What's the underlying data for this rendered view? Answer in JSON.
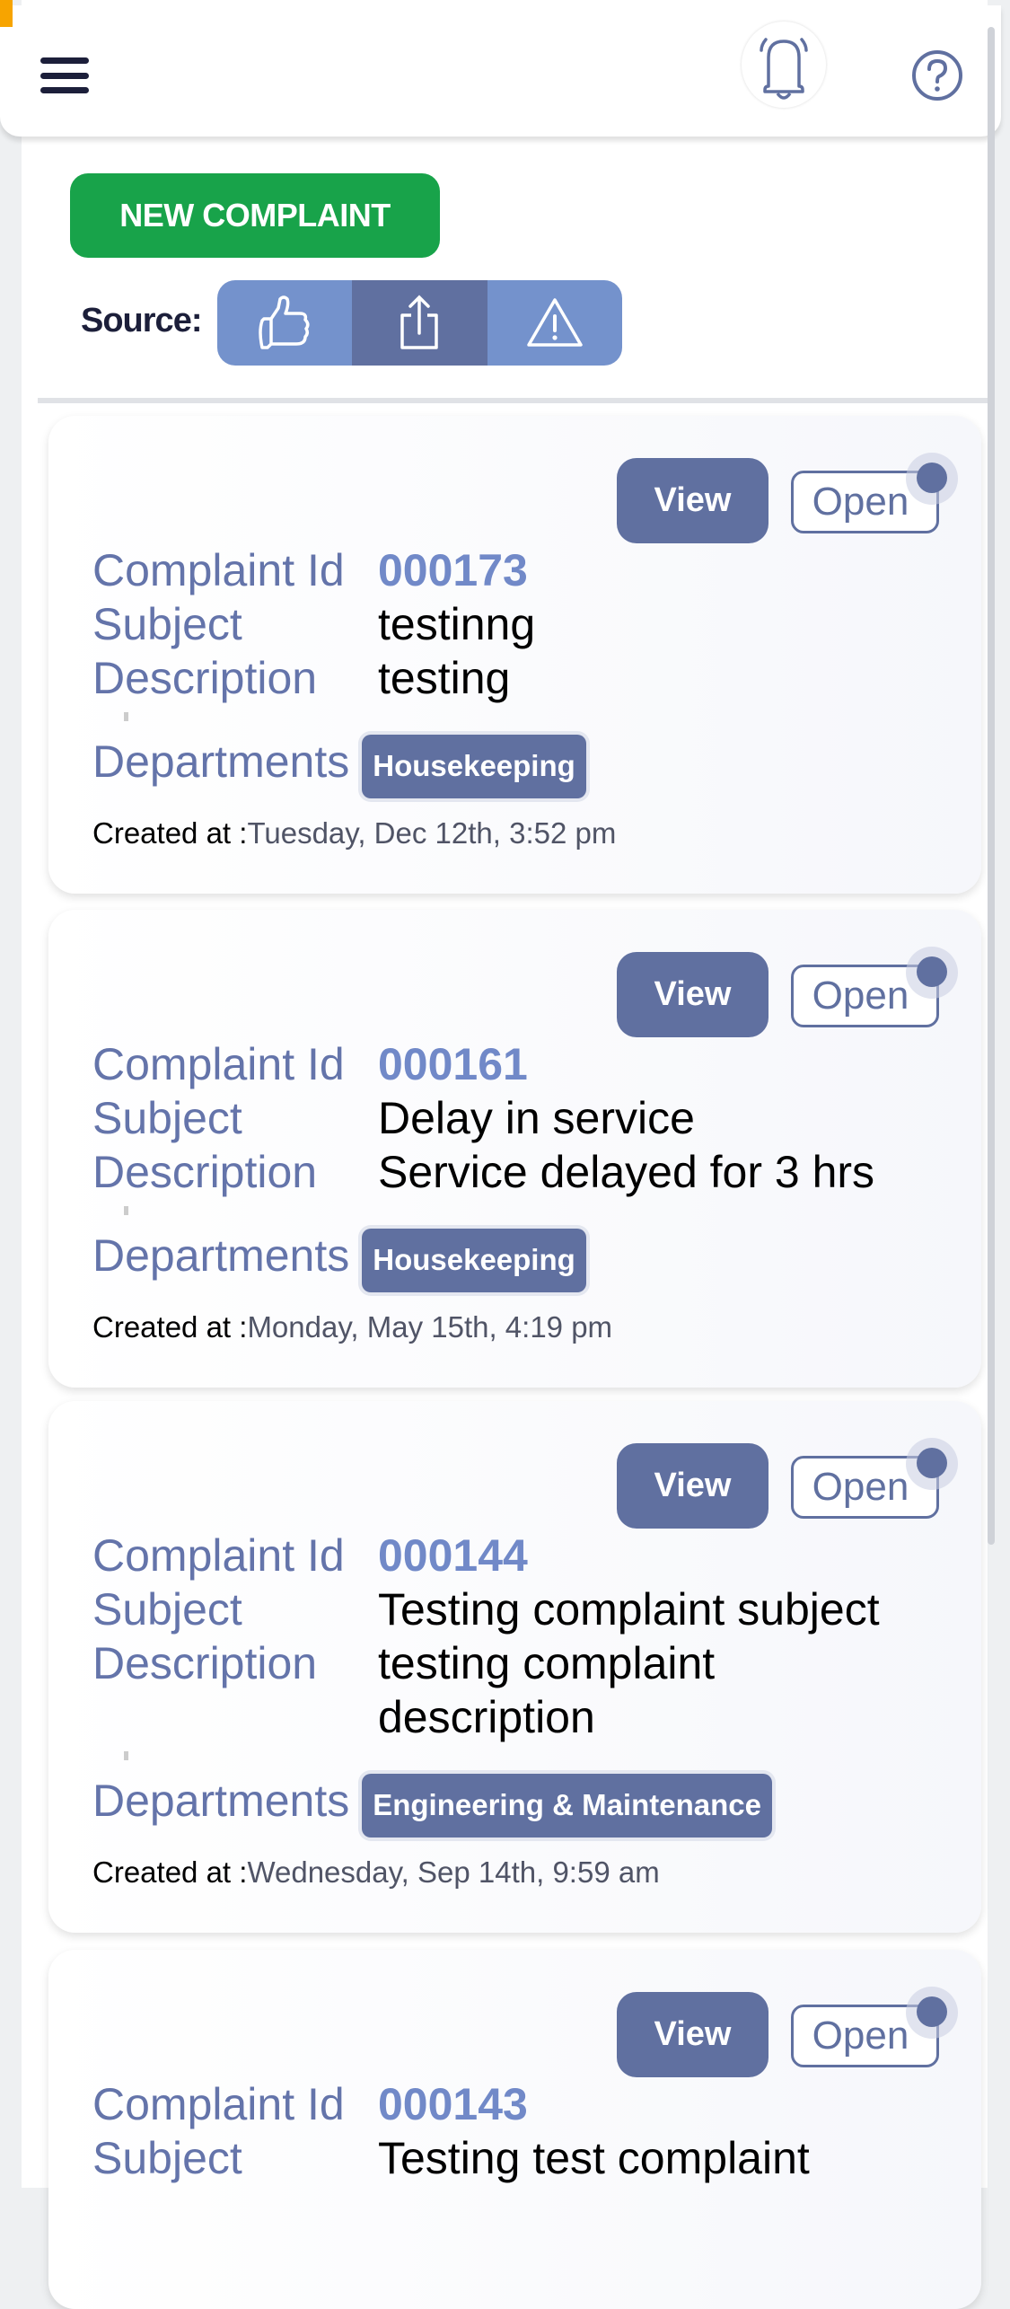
{
  "header": {
    "menu_icon": "hamburger-icon",
    "bell_icon": "bell-icon",
    "help_icon": "help-circle-icon"
  },
  "toolbar": {
    "new_complaint_label": "NEW COMPLAINT",
    "source_label": "Source:",
    "source_options": [
      {
        "icon": "thumbs-up-icon",
        "active": false
      },
      {
        "icon": "share-upload-icon",
        "active": true
      },
      {
        "icon": "warning-triangle-icon",
        "active": false
      }
    ]
  },
  "labels": {
    "complaint_id": "Complaint Id",
    "subject": "Subject",
    "description": "Description",
    "departments": "Departments",
    "created_at": "Created at :",
    "view": "View",
    "open": "Open"
  },
  "colors": {
    "primary": "#6070a0",
    "accent": "#7189c8",
    "success": "#18a34a"
  },
  "complaints": [
    {
      "id": "000173",
      "subject": "testinng",
      "description": "testing",
      "department": "Housekeeping",
      "created": "Tuesday, Dec 12th, 3:52 pm"
    },
    {
      "id": "000161",
      "subject": "Delay in service",
      "description": "Service delayed for 3 hrs",
      "department": "Housekeeping",
      "created": "Monday, May 15th, 4:19 pm"
    },
    {
      "id": "000144",
      "subject": "Testing complaint subject",
      "description": "testing complaint description",
      "department": "Engineering & Maintenance",
      "created": "Wednesday, Sep 14th, 9:59 am"
    },
    {
      "id": "000143",
      "subject": "Testing test complaint"
    }
  ]
}
